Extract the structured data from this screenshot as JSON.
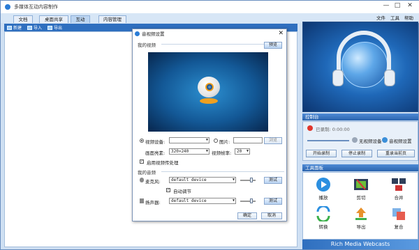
{
  "app": {
    "title": "多媒体互动内容制作",
    "window_controls": [
      "—",
      "□",
      "✕"
    ]
  },
  "tabs": [
    {
      "label": "文档"
    },
    {
      "label": "桌面共享"
    },
    {
      "label": "互动"
    },
    {
      "label": "内容管理"
    }
  ],
  "right_menu": [
    "文件",
    "工具",
    "帮助"
  ],
  "toolbar": {
    "new_label": "新建",
    "import_label": "导入",
    "export_label": "导出"
  },
  "dialog": {
    "title": "音视频设置",
    "close": "✕",
    "video_section": "我的视频",
    "preview_button": "预览",
    "video_device_label": "视频设备:",
    "video_device_value": "",
    "image_label": "图片:",
    "image_value": "",
    "browse_button": "浏览",
    "resolution_label": "画面亮素:",
    "resolution_value": "320×240",
    "framerate_label": "视频帧率:",
    "framerate_value": "20",
    "enable_video_label": "启用视频传处理",
    "audio_section": "我的音频",
    "mic_label": "麦克风:",
    "mic_value": "default device",
    "mic_test": "测试",
    "auto_adjust_label": "自动调节",
    "speaker_label": "扬声器:",
    "speaker_value": "default device",
    "speaker_test": "测试",
    "ok_button": "确定",
    "cancel_button": "取消"
  },
  "control_panel": {
    "header": "控制台",
    "recorded_label": "已录制: 0:00:00",
    "no_video_device": "无视频设备",
    "audio_video_settings": "音视频设置",
    "start_record": "开始录制",
    "stop_record": "停止录制",
    "rerecord_page": "重录当前页"
  },
  "tool_panel": {
    "header": "工具面板",
    "tools": [
      {
        "label": "播放"
      },
      {
        "label": "剪切"
      },
      {
        "label": "合并"
      },
      {
        "label": "转换"
      },
      {
        "label": "导出"
      },
      {
        "label": "复合"
      }
    ]
  },
  "footer": {
    "brand": "Rich Media Webcasts"
  },
  "colors": {
    "accent": "#2f6fbf",
    "panel_bg": "#cfe0f3",
    "record_red": "#e0362c"
  }
}
